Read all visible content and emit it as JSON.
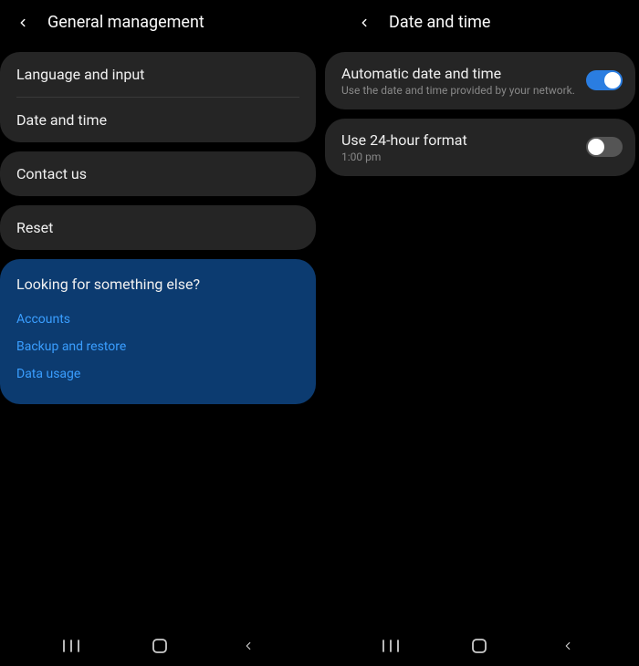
{
  "left": {
    "title": "General management",
    "items": {
      "group1": [
        "Language and input",
        "Date and time"
      ],
      "contact": "Contact us",
      "reset": "Reset"
    },
    "lookingFor": {
      "title": "Looking for something else?",
      "links": [
        "Accounts",
        "Backup and restore",
        "Data usage"
      ]
    }
  },
  "right": {
    "title": "Date and time",
    "autoDate": {
      "title": "Automatic date and time",
      "sub": "Use the date and time provided by your network.",
      "on": true
    },
    "format24": {
      "title": "Use 24-hour format",
      "sub": "1:00 pm",
      "on": false
    }
  }
}
